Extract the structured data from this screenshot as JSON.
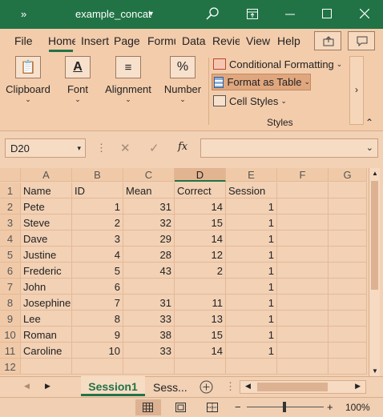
{
  "title_bar": {
    "chevrons": "»",
    "doc_title": "example_concat",
    "caret": "▾"
  },
  "ribbon_tabs": [
    "File",
    "Home",
    "Insert",
    "Page",
    "Formu",
    "Data",
    "Revie",
    "View",
    "Help"
  ],
  "ribbon": {
    "clipboard": "Clipboard",
    "font": "Font",
    "alignment": "Alignment",
    "number": "Number",
    "styles_items": [
      "Conditional Formatting",
      "Format as Table",
      "Cell Styles"
    ],
    "styles_group": "Styles"
  },
  "formula_bar": {
    "name_box": "D20",
    "fx": "fx",
    "value": ""
  },
  "columns": [
    "A",
    "B",
    "C",
    "D",
    "E",
    "F",
    "G"
  ],
  "rows": [
    [
      "Name",
      "ID",
      "Mean",
      "Correct",
      "Session"
    ],
    [
      "Pete",
      "1",
      "31",
      "14",
      "1"
    ],
    [
      "Steve",
      "2",
      "32",
      "15",
      "1"
    ],
    [
      "Dave",
      "3",
      "29",
      "14",
      "1"
    ],
    [
      "Justine",
      "4",
      "28",
      "12",
      "1"
    ],
    [
      "Frederic",
      "5",
      "43",
      "2",
      "1"
    ],
    [
      "John",
      "6",
      "",
      "",
      "1"
    ],
    [
      "Josephine",
      "7",
      "31",
      "11",
      "1"
    ],
    [
      "Lee",
      "8",
      "33",
      "13",
      "1"
    ],
    [
      "Roman",
      "9",
      "38",
      "15",
      "1"
    ],
    [
      "Caroline",
      "10",
      "33",
      "14",
      "1"
    ],
    [
      "",
      "",
      "",
      "",
      ""
    ]
  ],
  "sheet_tabs": {
    "active": "Session1",
    "other": "Sess",
    "more": "..."
  },
  "status": {
    "zoom": "100%"
  }
}
